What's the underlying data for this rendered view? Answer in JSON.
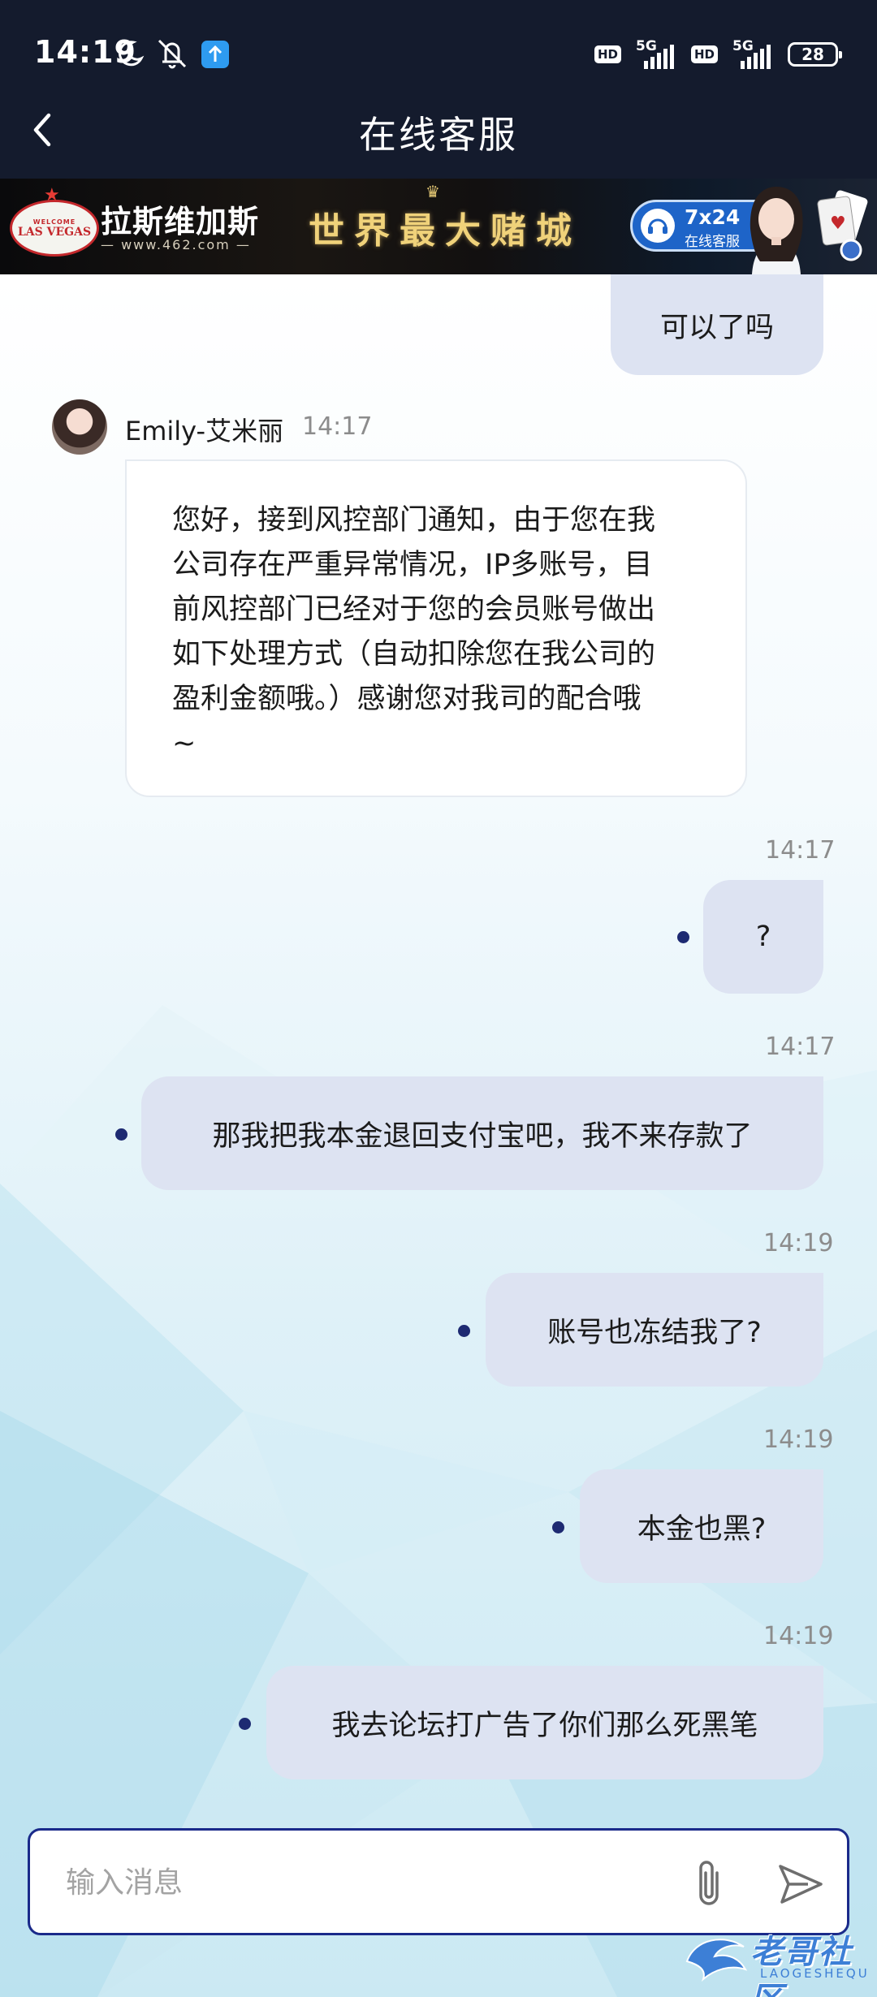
{
  "status_bar": {
    "time": "14:19",
    "hd1": "HD",
    "net1": "5G",
    "hd2": "HD",
    "net2": "5G",
    "battery": "28",
    "icons": [
      "moon-icon",
      "mute-icon",
      "app-notification-icon",
      "signal-icon",
      "battery-icon"
    ]
  },
  "header": {
    "title": "在线客服",
    "back_icon": "chevron-left-icon"
  },
  "banner": {
    "name": "拉斯维加斯",
    "url": "— www.462.com —",
    "slogan": "世界最大赌城",
    "service_hours": "7x24",
    "service_label": "在线客服",
    "sign_welcome": "WELCOME",
    "sign_text": "LAS VEGAS"
  },
  "chat": {
    "messages": [
      {
        "from": "user",
        "text": "可以了吗"
      },
      {
        "from": "agent",
        "name": "Emily-艾米丽",
        "time": "14:17",
        "text": "您好，接到风控部门通知，由于您在我公司存在严重异常情况，IP多账号，目前风控部门已经对于您的会员账号做出如下处理方式（自动扣除您在我公司的盈利金额哦。）感谢您对我司的配合哦~",
        "lines": [
          "您好，接到风控部门通知，由于您在我",
          "公司存在严重异常情况，IP多账号，目",
          "前风控部门已经对于您的会员账号做出",
          "如下处理方式（自动扣除您在我公司的",
          "盈利金额哦。）感谢您对我司的配合哦",
          "~"
        ]
      },
      {
        "from": "user",
        "time": "14:17",
        "text": "?"
      },
      {
        "from": "user",
        "time": "14:17",
        "text": "那我把我本金退回支付宝吧，我不来存款了"
      },
      {
        "from": "user",
        "time": "14:19",
        "text": "账号也冻结我了?"
      },
      {
        "from": "user",
        "time": "14:19",
        "text": "本金也黑?"
      },
      {
        "from": "user",
        "time": "14:19",
        "text": "我去论坛打广告了你们那么死黑笔"
      }
    ]
  },
  "input": {
    "placeholder": "输入消息",
    "value": ""
  },
  "watermark": {
    "text": "老哥社区",
    "sub": "LAOGESHEQU"
  },
  "colors": {
    "header_bg": "#141b2d",
    "outgoing_bubble": "#dde3f2",
    "read_dot": "#1d2a72",
    "input_border": "#1a2a8a"
  }
}
